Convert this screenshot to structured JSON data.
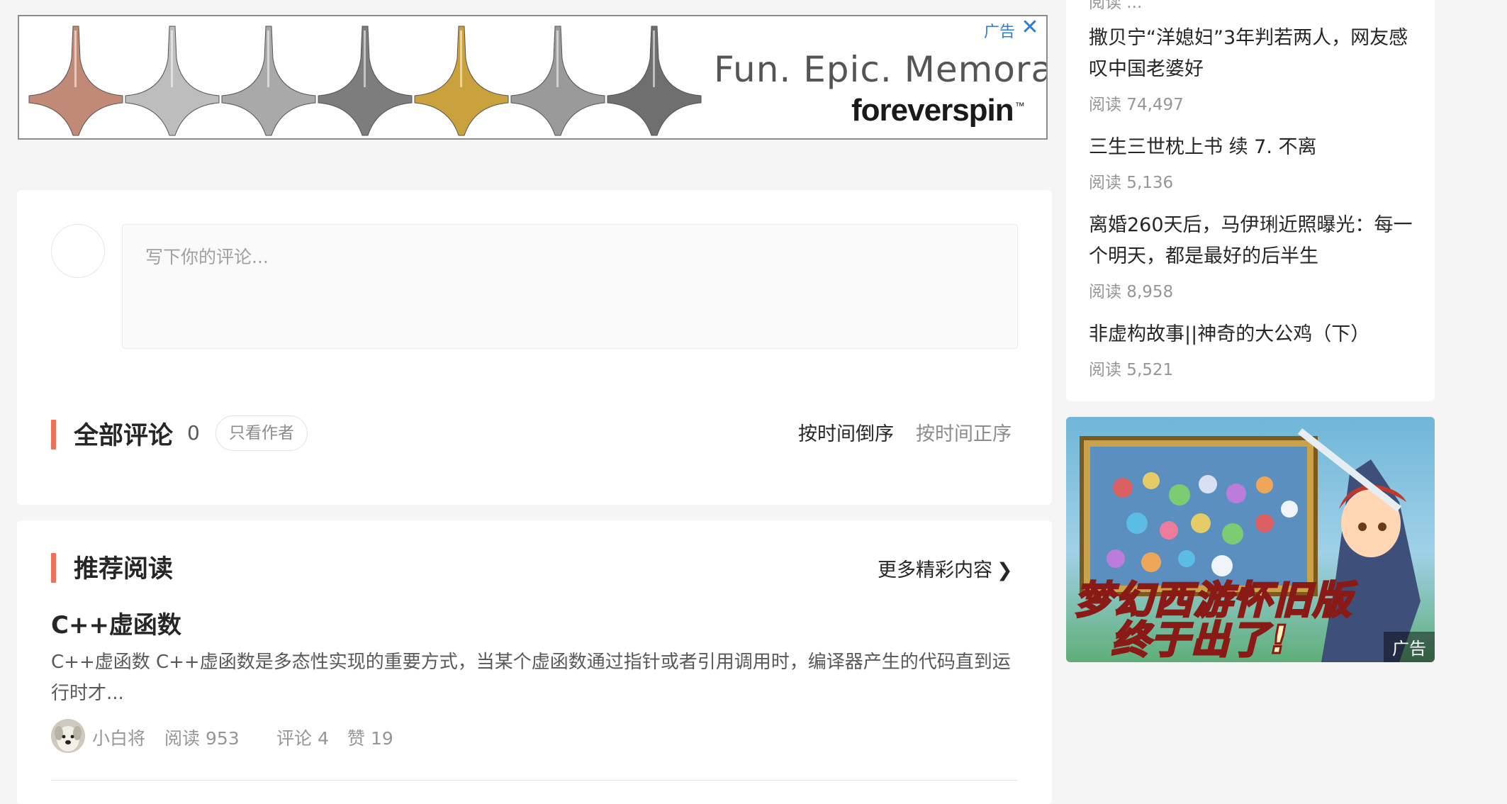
{
  "top_ad": {
    "slogan": "Fun. Epic. Memorable.",
    "brand": "foreverspin",
    "trademark": "™",
    "ad_label": "广告",
    "close_icon": "close-icon",
    "top_colors": [
      "#c08a76",
      "#bdbdbd",
      "#a9a9a9",
      "#7d7d7d",
      "#c9a23e",
      "#9a9a9a",
      "#6f6f6f"
    ]
  },
  "comment": {
    "placeholder": "写下你的评论...",
    "section_title": "全部评论",
    "count": "0",
    "author_only": "只看作者",
    "sort_desc": "按时间倒序",
    "sort_asc": "按时间正序"
  },
  "recommend": {
    "section_title": "推荐阅读",
    "more_link": "更多精彩内容",
    "more_icon": "chevron-right-icon",
    "article": {
      "title": "C++虚函数",
      "excerpt": "C++虚函数 C++虚函数是多态性实现的重要方式，当某个虚函数通过指针或者引用调用时，编译器产生的代码直到运行时才...",
      "author": "小白将",
      "reads": "阅读 953",
      "comments": "评论 4",
      "likes": "赞 19"
    }
  },
  "sidebar": {
    "items": [
      {
        "title": "撒贝宁“洋媳妇”3年判若两人，网友感叹中国老婆好",
        "reads": "阅读 74,497"
      },
      {
        "title": "三生三世枕上书 续 7. 不离",
        "reads": "阅读 5,136"
      },
      {
        "title": "离婚260天后，马伊琍近照曝光：每一个明天，都是最好的后半生",
        "reads": "阅读 8,958"
      },
      {
        "title": "非虚构故事||神奇的大公鸡（下）",
        "reads": "阅读 5,521"
      }
    ],
    "game_ad": {
      "line1": "梦幻西游怀旧版",
      "line2": "终于出了!",
      "ad_label": "广告"
    }
  },
  "colors": {
    "accent": "#ec7259",
    "page_bg": "#f5f5f5",
    "ad_link": "#2a7fd4"
  }
}
